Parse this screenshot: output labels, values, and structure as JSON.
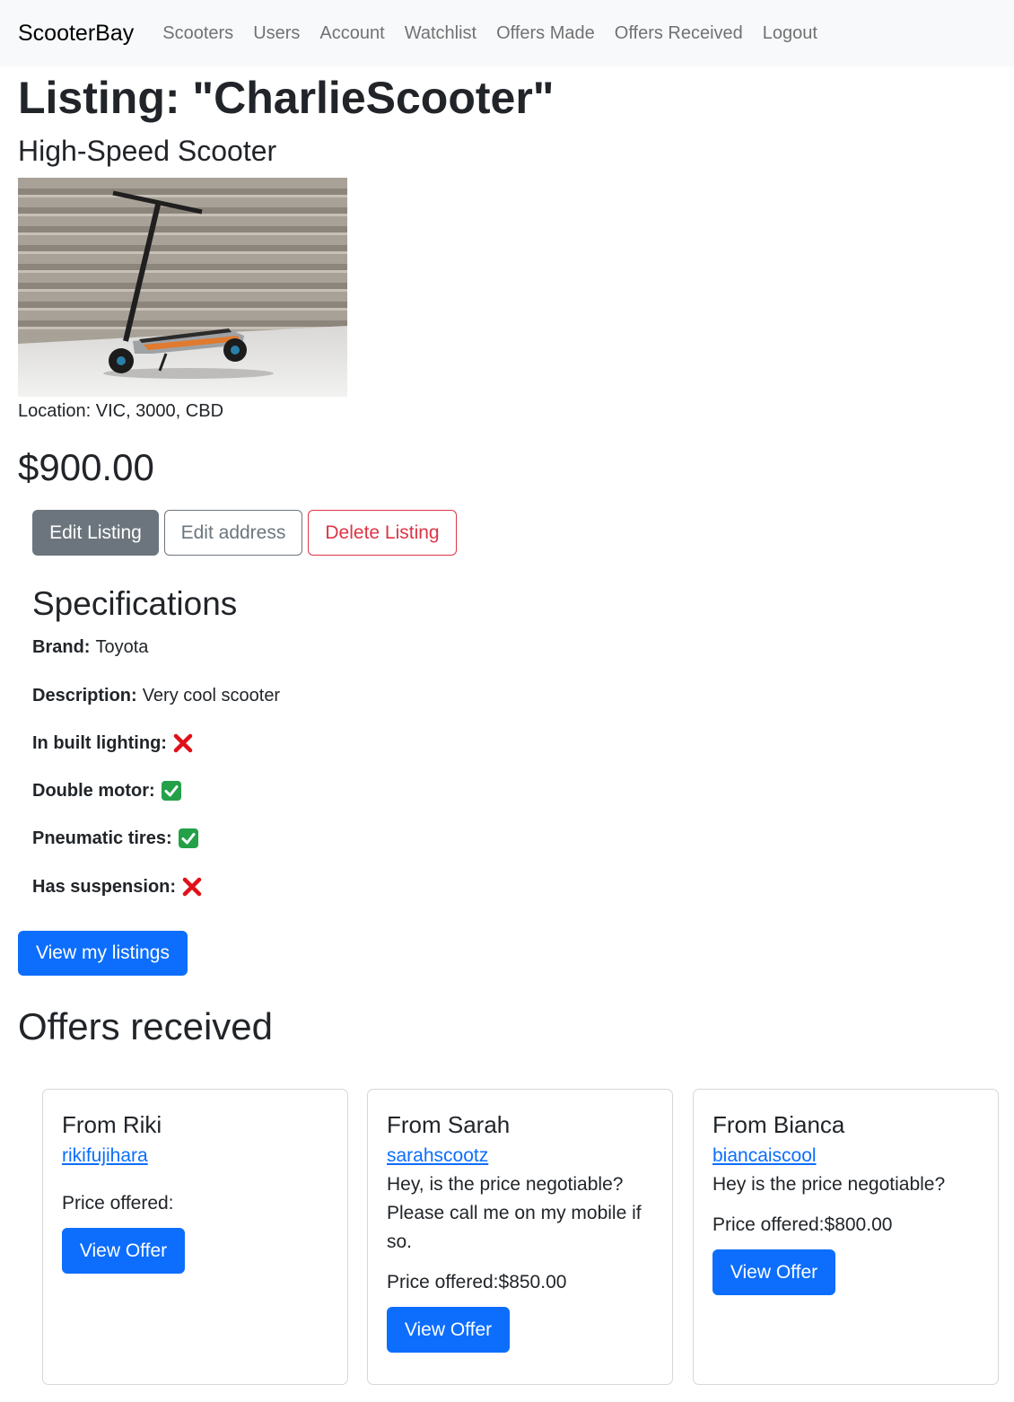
{
  "navbar": {
    "brand": "ScooterBay",
    "links": [
      "Scooters",
      "Users",
      "Account",
      "Watchlist",
      "Offers Made",
      "Offers Received",
      "Logout"
    ]
  },
  "listing": {
    "title": "Listing: \"CharlieScooter\"",
    "subtitle": "High-Speed Scooter",
    "location": "Location: VIC, 3000, CBD",
    "price": "$900.00"
  },
  "actions": {
    "edit_listing": "Edit Listing",
    "edit_address": "Edit address",
    "delete_listing": "Delete Listing"
  },
  "specifications": {
    "title": "Specifications",
    "rows": [
      {
        "label": "Brand:",
        "value": "Toyota"
      },
      {
        "label": "Description:",
        "value": "Very cool scooter"
      },
      {
        "label": "In built lighting:",
        "icon": "cross-mark-icon"
      },
      {
        "label": "Double motor:",
        "icon": "check-mark-icon"
      },
      {
        "label": "Pneumatic tires:",
        "icon": "check-mark-icon"
      },
      {
        "label": "Has suspension:",
        "icon": "cross-mark-icon"
      }
    ]
  },
  "view_listings": "View my listings",
  "offers": {
    "title": "Offers received",
    "price_label": "Price offered:",
    "view_label": "View Offer",
    "cards": [
      {
        "from": "From Riki",
        "user": "rikifujihara",
        "message": "",
        "price": ""
      },
      {
        "from": "From Sarah",
        "user": "sarahscootz",
        "message": "Hey, is the price negotiable? Please call me on my mobile if so.",
        "price": "$850.00"
      },
      {
        "from": "From Bianca",
        "user": "biancaiscool",
        "message": "Hey is the price negotiable?",
        "price": "$800.00"
      }
    ]
  },
  "colors": {
    "primary": "#0d6efd",
    "secondary": "#6c757d",
    "danger": "#dc3545",
    "check": "#24a148",
    "cross": "#e0101a"
  }
}
